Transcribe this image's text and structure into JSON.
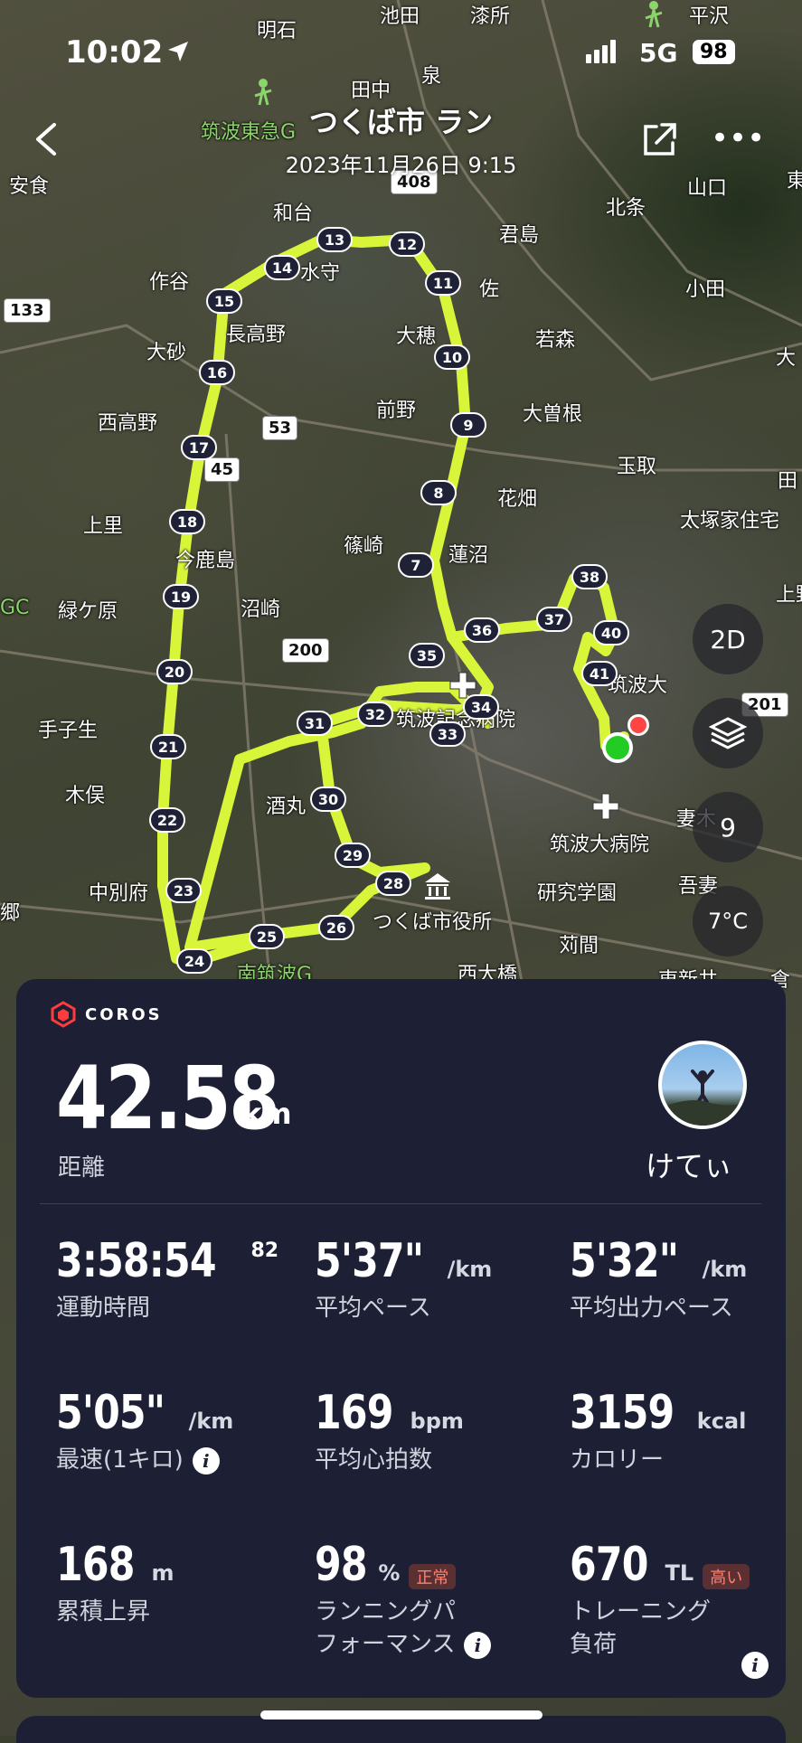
{
  "status_bar": {
    "time": "10:02",
    "network": "5G",
    "battery": "98"
  },
  "header": {
    "title": "つくば市 ラン",
    "date": "2023年11月26日 9:15"
  },
  "map": {
    "place_labels": [
      {
        "text": "明石"
      },
      {
        "text": "池田"
      },
      {
        "text": "漆所"
      },
      {
        "text": "平沢"
      },
      {
        "text": "泉"
      },
      {
        "text": "田中"
      },
      {
        "text": "筑波東急G"
      },
      {
        "text": "安食"
      },
      {
        "text": "山口"
      },
      {
        "text": "東"
      },
      {
        "text": "和台"
      },
      {
        "text": "北条"
      },
      {
        "text": "君島"
      },
      {
        "text": "作谷"
      },
      {
        "text": "水守"
      },
      {
        "text": "佐"
      },
      {
        "text": "小田"
      },
      {
        "text": "長高野"
      },
      {
        "text": "大穂"
      },
      {
        "text": "若森"
      },
      {
        "text": "大砂"
      },
      {
        "text": "大"
      },
      {
        "text": "前野"
      },
      {
        "text": "大曽根"
      },
      {
        "text": "西高野"
      },
      {
        "text": "玉取"
      },
      {
        "text": "花畑"
      },
      {
        "text": "田"
      },
      {
        "text": "太塚家住宅"
      },
      {
        "text": "上里"
      },
      {
        "text": "篠崎"
      },
      {
        "text": "蓮沼"
      },
      {
        "text": "今鹿島"
      },
      {
        "text": "上野"
      },
      {
        "text": "GC"
      },
      {
        "text": "沼崎"
      },
      {
        "text": "緑ケ原"
      },
      {
        "text": "筑波大"
      },
      {
        "text": "手子生"
      },
      {
        "text": "筑波記念病院"
      },
      {
        "text": "木俣"
      },
      {
        "text": "酒丸"
      },
      {
        "text": "妻木"
      },
      {
        "text": "筑波大病院"
      },
      {
        "text": "中別府"
      },
      {
        "text": "研究学園"
      },
      {
        "text": "吾妻"
      },
      {
        "text": "郷"
      },
      {
        "text": "つくば市役所"
      },
      {
        "text": "苅間"
      },
      {
        "text": "南筑波G"
      },
      {
        "text": "西大橋"
      },
      {
        "text": "東新井"
      },
      {
        "text": "倉"
      }
    ],
    "road_numbers": [
      "408",
      "133",
      "53",
      "45",
      "200",
      "201"
    ],
    "km_markers": [
      "7",
      "8",
      "9",
      "10",
      "11",
      "12",
      "13",
      "14",
      "15",
      "16",
      "17",
      "18",
      "19",
      "20",
      "21",
      "22",
      "23",
      "24",
      "25",
      "26",
      "28",
      "29",
      "30",
      "31",
      "32",
      "33",
      "34",
      "35",
      "36",
      "37",
      "38",
      "40",
      "41"
    ],
    "controls": {
      "view_2d": "2D",
      "compass_value": "9",
      "temperature": "7°C"
    }
  },
  "card": {
    "brand": "COROS",
    "distance": {
      "value": "42.58",
      "unit": "km",
      "label": "距離"
    },
    "user": {
      "name": "けてぃ"
    },
    "stats": [
      {
        "value": "3:58:54",
        "sup": "82",
        "unit": "",
        "label": "運動時間"
      },
      {
        "value": "5'37\"",
        "unit": "/km",
        "label": "平均ペース"
      },
      {
        "value": "5'32\"",
        "unit": "/km",
        "label": "平均出力ペース"
      },
      {
        "value": "5'05\"",
        "unit": "/km",
        "label": "最速(1キロ)"
      },
      {
        "value": "169",
        "unit": "bpm",
        "label": "平均心拍数"
      },
      {
        "value": "3159",
        "unit": "kcal",
        "label": "カロリー"
      },
      {
        "value": "168",
        "unit": "m",
        "label": "累積上昇"
      },
      {
        "value": "98",
        "unit": "%",
        "tag": "正常",
        "label_line1": "ランニングパ",
        "label_line2": "フォーマンス"
      },
      {
        "value": "670",
        "unit": "TL",
        "tag": "高い",
        "label_line1": "トレーニング",
        "label_line2": "負荷"
      }
    ]
  },
  "colors": {
    "route": "#d8f53a",
    "card_bg": "#1d2035",
    "start_marker": "#22cc22",
    "end_marker": "#ff4444"
  }
}
